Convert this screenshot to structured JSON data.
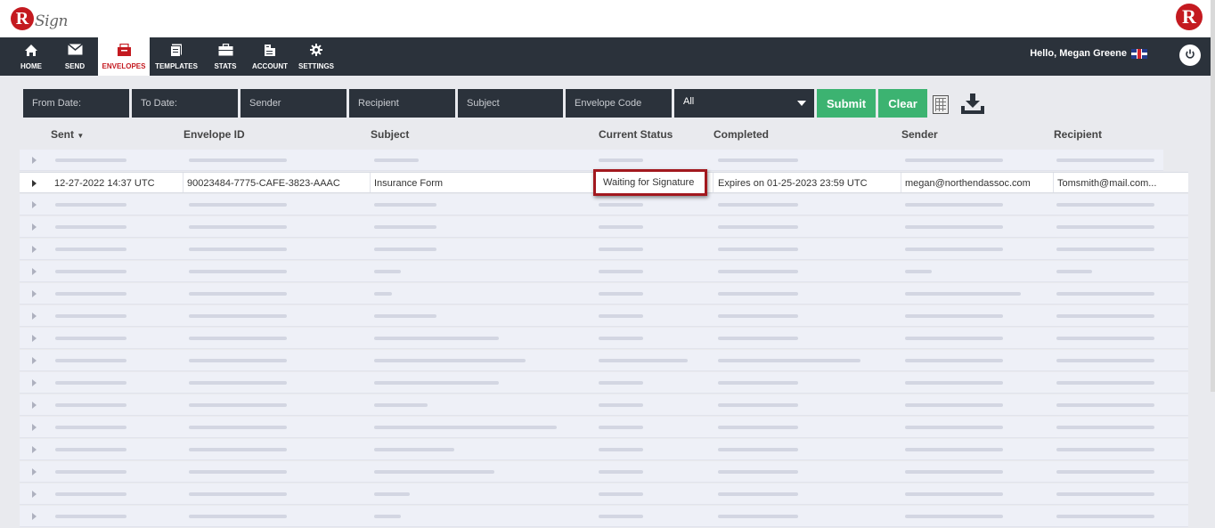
{
  "brand": {
    "logo_letter": "R",
    "logo_text": "Sign",
    "right_logo_letter": "R"
  },
  "nav": {
    "items": [
      {
        "label": "HOME",
        "icon": "home-icon"
      },
      {
        "label": "SEND",
        "icon": "envelope-icon"
      },
      {
        "label": "ENVELOPES",
        "icon": "inbox-icon",
        "active": true
      },
      {
        "label": "TEMPLATES",
        "icon": "templates-icon"
      },
      {
        "label": "STATS",
        "icon": "briefcase-icon"
      },
      {
        "label": "ACCOUNT",
        "icon": "account-icon"
      },
      {
        "label": "SETTINGS",
        "icon": "gear-icon"
      }
    ],
    "greeting": "Hello, Megan Greene"
  },
  "filters": {
    "from_date": "From Date:",
    "to_date": "To Date:",
    "sender": "Sender",
    "recipient": "Recipient",
    "subject": "Subject",
    "envelope_code": "Envelope Code",
    "status_select": "All",
    "submit": "Submit",
    "clear": "Clear"
  },
  "table": {
    "columns": [
      "Sent",
      "Envelope ID",
      "Subject",
      "Current Status",
      "Completed",
      "Sender",
      "Recipient"
    ],
    "focused_row": {
      "sent": "12-27-2022 14:37 UTC",
      "envelope_id": "90023484-7775-CAFE-3823-AAAC",
      "subject": "Insurance Form",
      "status": "Waiting for Signature",
      "completed": "Expires on 01-25-2023 23:59 UTC",
      "sender": "megan@northendassoc.com",
      "recipient": "Tomsmith@mail.com..."
    }
  },
  "colors": {
    "nav_bg": "#2b323b",
    "accent_red": "#c41a20",
    "green": "#3cb371",
    "highlight_border": "#a2181e"
  }
}
